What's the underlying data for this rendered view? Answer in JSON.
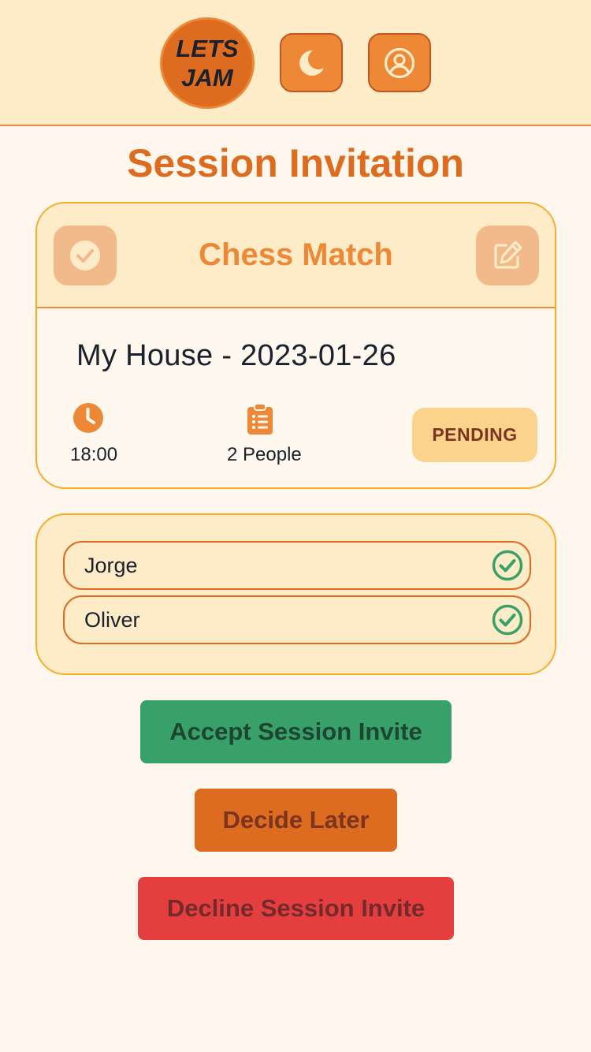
{
  "header": {
    "logo_line1": "LETS",
    "logo_line2": "JAM",
    "theme_icon": "moon-icon",
    "profile_icon": "user-circle-icon"
  },
  "page": {
    "title": "Session Invitation"
  },
  "session": {
    "name": "Chess Match",
    "location_date": "My House - 2023-01-26",
    "time": "18:00",
    "people": "2 People",
    "status": "PENDING",
    "confirm_icon": "check-circle-icon",
    "edit_icon": "edit-icon"
  },
  "attendees": [
    {
      "name": "Jorge",
      "status_icon": "check-circle-icon"
    },
    {
      "name": "Oliver",
      "status_icon": "check-circle-icon"
    }
  ],
  "actions": {
    "accept_label": "Accept Session Invite",
    "later_label": "Decide Later",
    "decline_label": "Decline Session Invite"
  },
  "colors": {
    "background": "#fff7ee",
    "header_bg": "#feebc8",
    "accent": "#dd6b20",
    "accent_light": "#ed8936",
    "accept": "#38a169",
    "decline": "#e53e3e",
    "pending_badge": "#fbd38d"
  }
}
